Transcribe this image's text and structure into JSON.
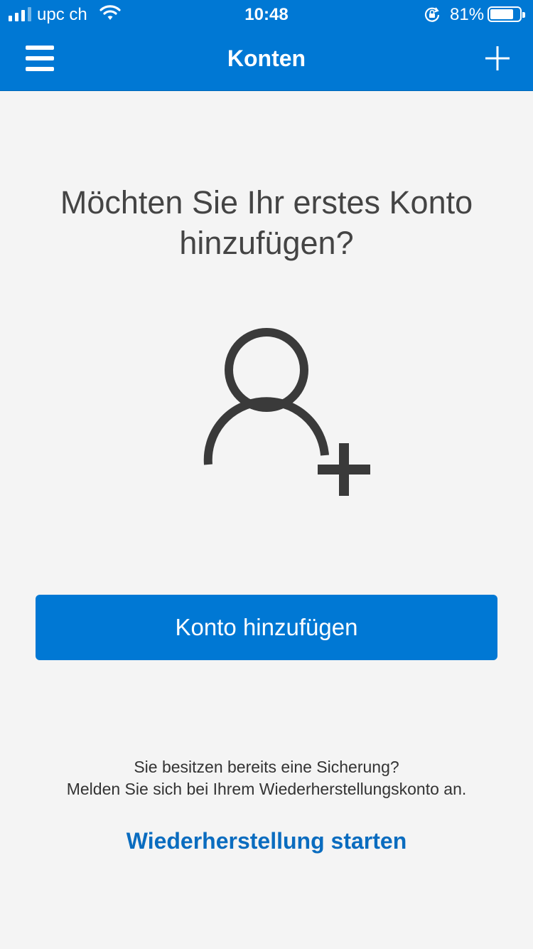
{
  "status_bar": {
    "carrier": "upc ch",
    "time": "10:48",
    "battery_percent": "81%",
    "battery_level": 0.81,
    "signal_bars_filled": 3,
    "signal_bars_total": 4
  },
  "nav": {
    "title": "Konten",
    "menu_icon": "hamburger-menu-icon",
    "add_icon": "plus-icon"
  },
  "main": {
    "heading": "Möchten Sie Ihr erstes Konto hinzufügen?",
    "illustration_icon": "add-person-icon",
    "add_account_button": "Konto hinzufügen",
    "backup_question": "Sie besitzen bereits eine Sicherung?",
    "backup_instruction": "Melden Sie sich bei Ihrem Wiederherstellungskonto an.",
    "restore_link": "Wiederherstellung starten"
  },
  "colors": {
    "accent": "#0078d4",
    "link": "#0a6cbf",
    "background": "#f4f4f4",
    "icon_dark": "#3a3a3a"
  }
}
